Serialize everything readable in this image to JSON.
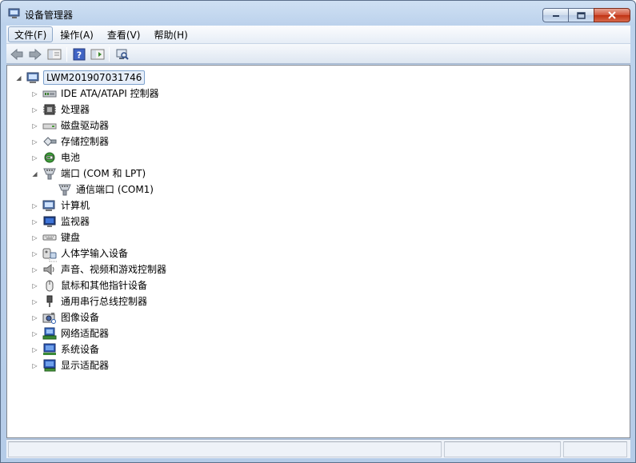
{
  "window": {
    "title": "设备管理器"
  },
  "menu": [
    {
      "label": "文件(F)"
    },
    {
      "label": "操作(A)"
    },
    {
      "label": "查看(V)"
    },
    {
      "label": "帮助(H)"
    }
  ],
  "toolbar": {
    "buttons": [
      "back-arrow-icon",
      "forward-arrow-icon",
      "show-hide-tree-icon",
      "help-icon",
      "properties-icon",
      "scan-hardware-icon"
    ]
  },
  "tree": {
    "root": {
      "label": "LWM201907031746",
      "icon": "computer-icon",
      "expanded": true
    },
    "categories": [
      {
        "label": "IDE ATA/ATAPI 控制器",
        "icon": "ide-controller-icon",
        "expanded": false
      },
      {
        "label": "处理器",
        "icon": "processor-icon",
        "expanded": false
      },
      {
        "label": "磁盘驱动器",
        "icon": "disk-drive-icon",
        "expanded": false
      },
      {
        "label": "存储控制器",
        "icon": "storage-controller-icon",
        "expanded": false
      },
      {
        "label": "电池",
        "icon": "battery-icon",
        "expanded": false
      },
      {
        "label": "端口 (COM 和 LPT)",
        "icon": "port-icon",
        "expanded": true,
        "children": [
          {
            "label": "通信端口 (COM1)",
            "icon": "port-icon"
          }
        ]
      },
      {
        "label": "计算机",
        "icon": "computer-icon",
        "expanded": false
      },
      {
        "label": "监视器",
        "icon": "monitor-icon",
        "expanded": false
      },
      {
        "label": "键盘",
        "icon": "keyboard-icon",
        "expanded": false
      },
      {
        "label": "人体学输入设备",
        "icon": "hid-icon",
        "expanded": false
      },
      {
        "label": "声音、视频和游戏控制器",
        "icon": "speaker-icon",
        "expanded": false
      },
      {
        "label": "鼠标和其他指针设备",
        "icon": "mouse-icon",
        "expanded": false
      },
      {
        "label": "通用串行总线控制器",
        "icon": "usb-icon",
        "expanded": false
      },
      {
        "label": "图像设备",
        "icon": "camera-icon",
        "expanded": false
      },
      {
        "label": "网络适配器",
        "icon": "network-adapter-icon",
        "expanded": false
      },
      {
        "label": "系统设备",
        "icon": "system-device-icon",
        "expanded": false
      },
      {
        "label": "显示适配器",
        "icon": "display-adapter-icon",
        "expanded": false
      }
    ]
  }
}
